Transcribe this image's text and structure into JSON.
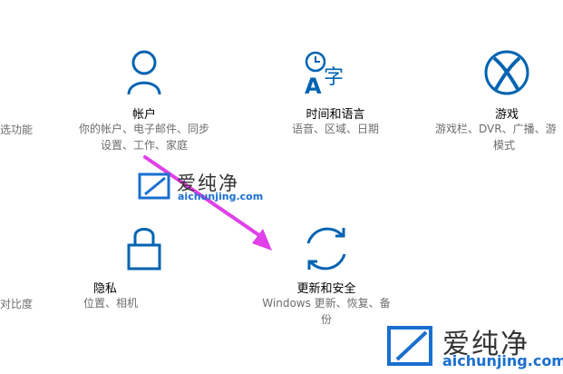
{
  "left_partial": {
    "row1": "选功能",
    "row2": "对比度"
  },
  "tiles": {
    "account": {
      "title": "帐户",
      "desc_line1": "你的帐户、电子邮件、同步",
      "desc_line2": "设置、工作、家庭",
      "icon": "person-icon"
    },
    "time_language": {
      "title": "时间和语言",
      "desc_line1": "语音、区域、日期",
      "icon": "time-language-icon",
      "icon_glyph": "字"
    },
    "gaming": {
      "title": "游戏",
      "desc_line1": "游戏栏、DVR、广播、游",
      "desc_line2": "模式",
      "icon": "xbox-icon"
    },
    "privacy": {
      "title": "隐私",
      "desc_line1": "位置、相机",
      "icon": "lock-icon"
    },
    "update_security": {
      "title": "更新和安全",
      "desc_line1": "Windows 更新、恢复、备",
      "desc_line2": "份",
      "icon": "sync-icon"
    }
  },
  "watermark_center": {
    "text": "爱纯净",
    "sub": "aichunjing.com"
  },
  "watermark_corner": {
    "text": "爱纯净",
    "sub": "aichunjing.com"
  },
  "colors": {
    "accent": "#0063b1",
    "arrow": "#e040e8",
    "watermark_blue": "#1a6fd0"
  }
}
